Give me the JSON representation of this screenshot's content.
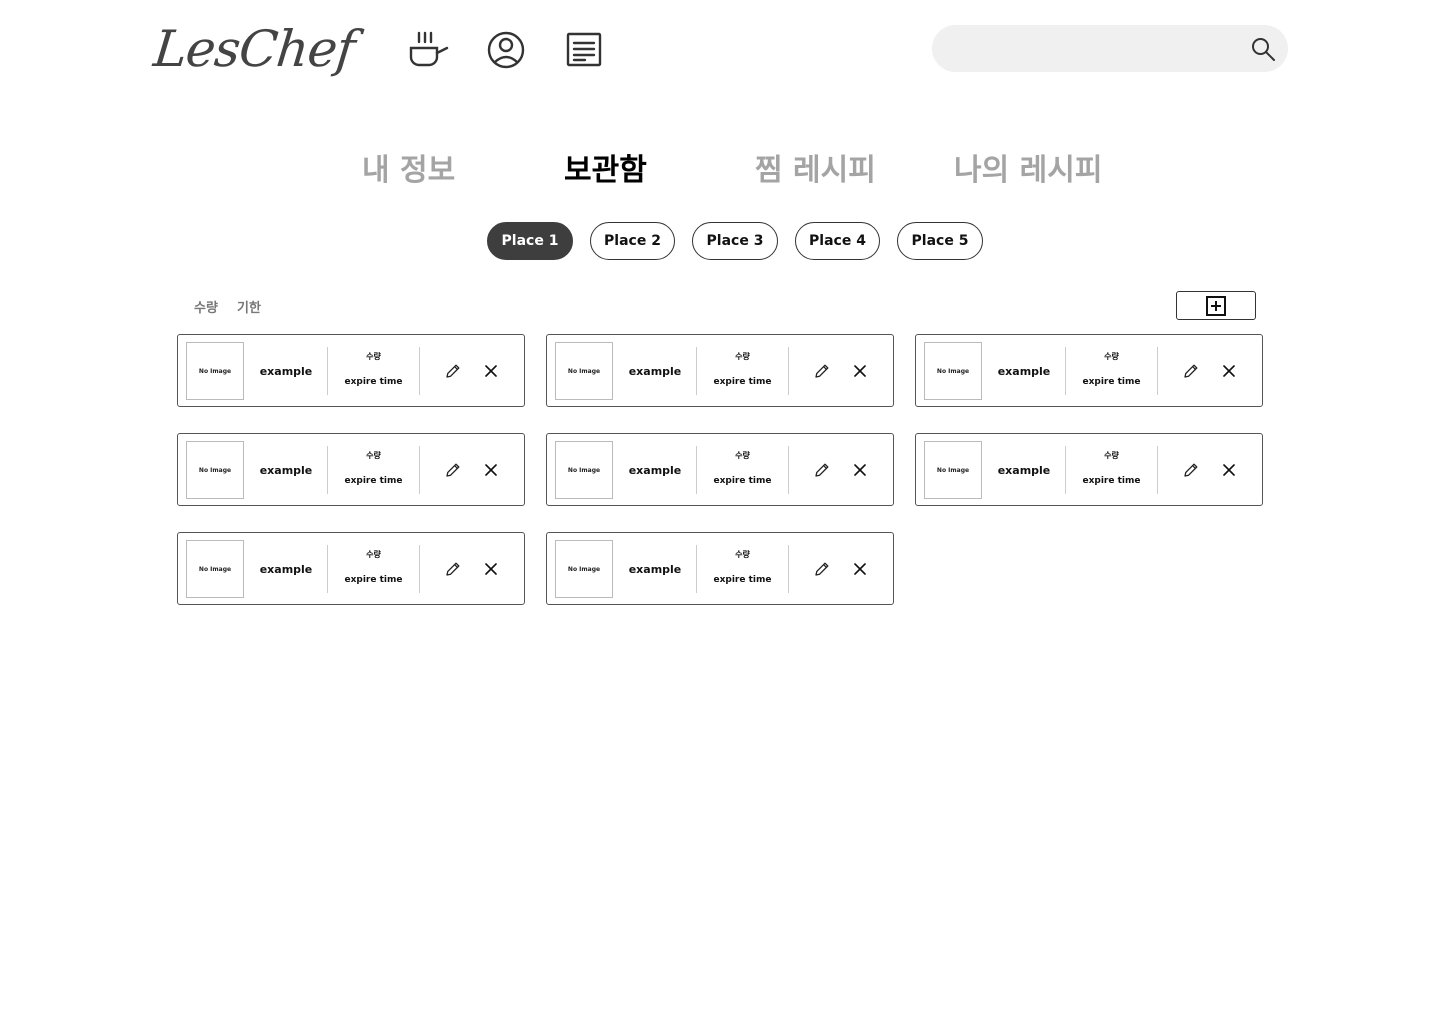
{
  "header": {
    "logo": "LesChef",
    "search": {
      "value": "",
      "placeholder": ""
    }
  },
  "icons": {
    "cooking": "cooking-pot-icon",
    "profile": "user-circle-icon",
    "recipes": "document-icon",
    "search": "search-icon",
    "add": "plus-square-icon",
    "edit": "pencil-icon",
    "delete": "close-icon"
  },
  "tabs": [
    {
      "label": "내 정보",
      "active": false
    },
    {
      "label": "보관함",
      "active": true
    },
    {
      "label": "찜 레시피",
      "active": false
    },
    {
      "label": "나의 레시피",
      "active": false
    }
  ],
  "places": [
    {
      "label": "Place 1",
      "active": true
    },
    {
      "label": "Place 2",
      "active": false
    },
    {
      "label": "Place 3",
      "active": false
    },
    {
      "label": "Place 4",
      "active": false
    },
    {
      "label": "Place 5",
      "active": false
    }
  ],
  "sort": {
    "quantity": "수량",
    "expiry": "기한"
  },
  "items": [
    {
      "image": "No Image",
      "name": "example",
      "quantity": "수량",
      "expire": "expire time"
    },
    {
      "image": "No Image",
      "name": "example",
      "quantity": "수량",
      "expire": "expire time"
    },
    {
      "image": "No Image",
      "name": "example",
      "quantity": "수량",
      "expire": "expire time"
    },
    {
      "image": "No Image",
      "name": "example",
      "quantity": "수량",
      "expire": "expire time"
    },
    {
      "image": "No Image",
      "name": "example",
      "quantity": "수량",
      "expire": "expire time"
    },
    {
      "image": "No Image",
      "name": "example",
      "quantity": "수량",
      "expire": "expire time"
    },
    {
      "image": "No Image",
      "name": "example",
      "quantity": "수량",
      "expire": "expire time"
    },
    {
      "image": "No Image",
      "name": "example",
      "quantity": "수량",
      "expire": "expire time"
    }
  ],
  "colors": {
    "active_pill": "#3e3e3e",
    "inactive_tab": "#a4a4a4",
    "search_bg": "#f0f0f0"
  }
}
